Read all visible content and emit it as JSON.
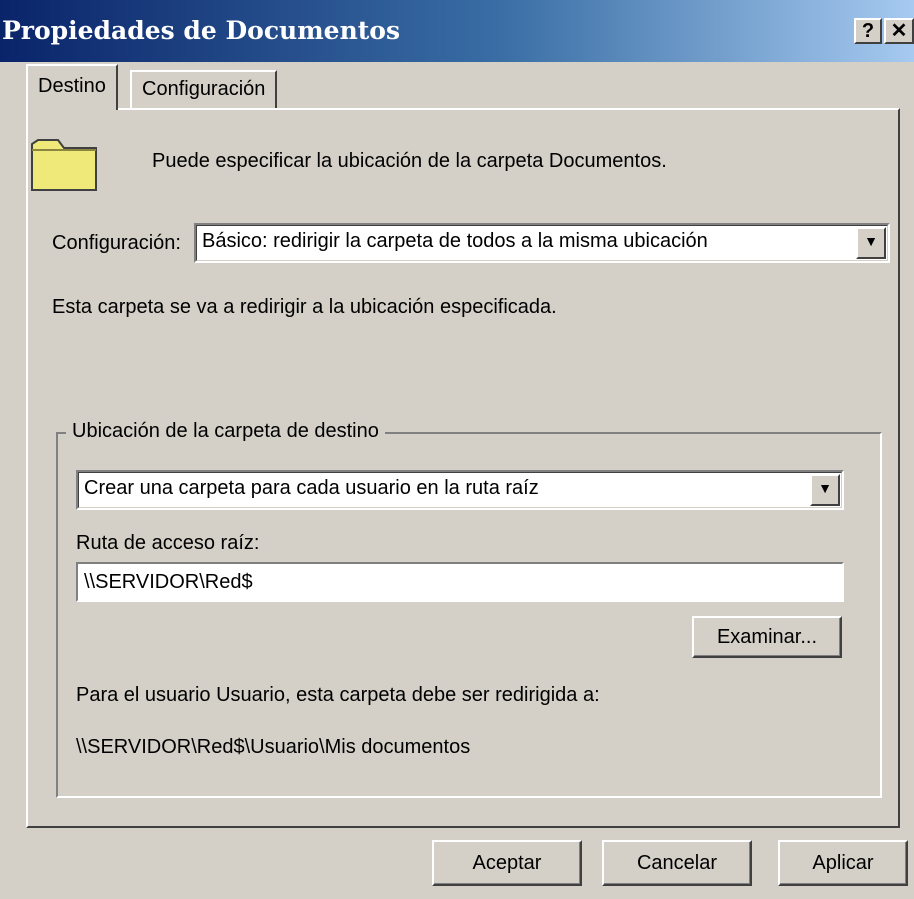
{
  "window": {
    "title": "Propiedades de Documentos",
    "help_glyph": "?",
    "close_glyph": "✕"
  },
  "tabs": [
    {
      "label": "Destino",
      "active": true
    },
    {
      "label": "Configuración",
      "active": false
    }
  ],
  "destino": {
    "description": "Puede especificar la ubicación de la carpeta Documentos.",
    "config_label": "Configuración:",
    "config_value": "Básico: redirigir la carpeta de todos a la misma ubicación",
    "status_text": "Esta carpeta se va a redirigir a la ubicación especificada.",
    "group": {
      "title": "Ubicación de la carpeta de destino",
      "location_value": "Crear una carpeta para cada usuario en la ruta raíz",
      "root_path_label": "Ruta de acceso raíz:",
      "root_path_value": "\\\\SERVIDOR\\Red$",
      "browse_label": "Examinar...",
      "user_info": "Para el usuario Usuario, esta carpeta debe ser redirigida a:",
      "resolved_path": "\\\\SERVIDOR\\Red$\\Usuario\\Mis documentos"
    }
  },
  "buttons": {
    "ok": "Aceptar",
    "cancel": "Cancelar",
    "apply": "Aplicar"
  },
  "icons": {
    "folder": "folder-icon",
    "dropdown": "chevron-down-icon"
  },
  "colors": {
    "dialog_face": "#d4d0c8",
    "title_start": "#0a246a",
    "title_end": "#a6caf0",
    "folder_fill": "#efe97a"
  }
}
